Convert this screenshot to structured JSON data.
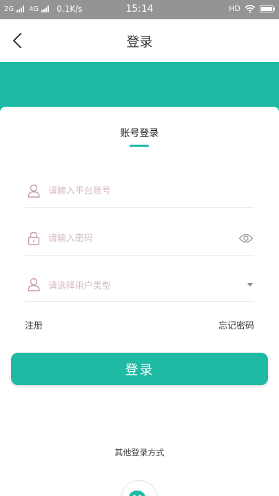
{
  "status_bar": {
    "network_1": "2G",
    "network_2": "4G",
    "speed": "0.1K/s",
    "time": "15:14",
    "hd": "HD"
  },
  "nav": {
    "title": "登录"
  },
  "tab": {
    "label": "账号登录"
  },
  "form": {
    "account_placeholder": "请输入平台账号",
    "password_placeholder": "请输入密码",
    "user_type_placeholder": "请选择用户类型"
  },
  "links": {
    "register": "注册",
    "forgot_password": "忘记密码"
  },
  "login_button": "登录",
  "other_methods_label": "其他登录方式",
  "colors": {
    "accent": "#1fbaa4",
    "status_bar": "#949494",
    "placeholder": "#d6b8c8"
  },
  "icons": {
    "back": "chevron-left-icon",
    "account": "user-icon",
    "password": "lock-icon",
    "user_type": "user-icon",
    "visibility": "eye-icon",
    "dropdown": "caret-down-icon",
    "other_login": "wechat-icon"
  }
}
